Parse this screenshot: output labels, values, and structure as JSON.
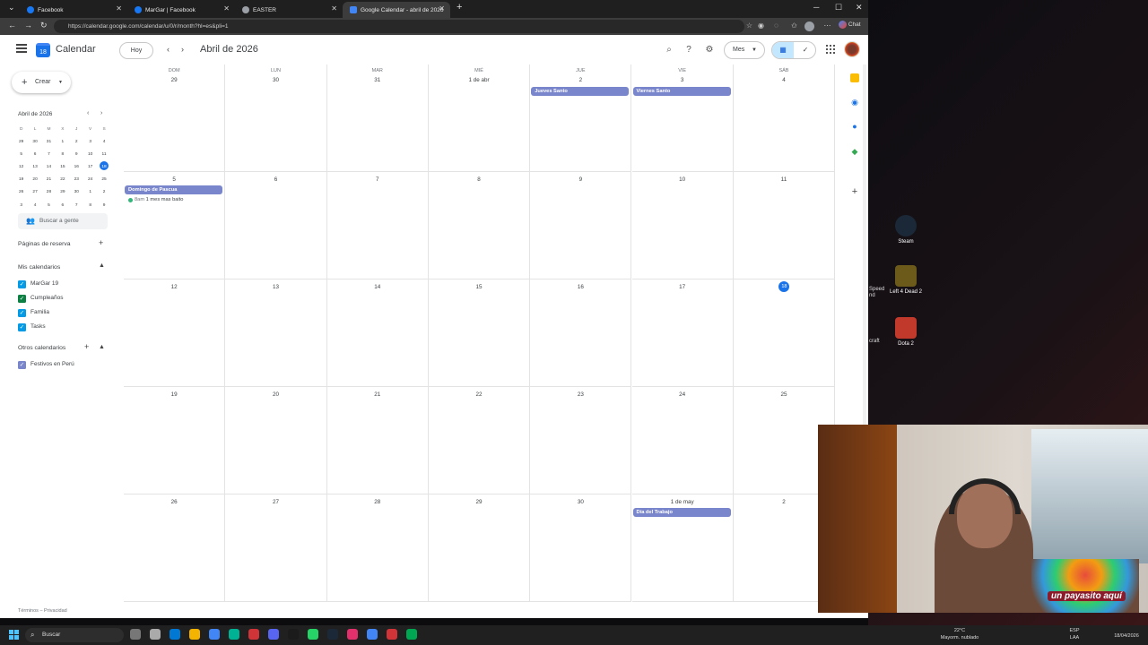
{
  "browser": {
    "tabs": [
      {
        "title": "Facebook",
        "favicon_color": "#1877f2"
      },
      {
        "title": "MarGar | Facebook",
        "favicon_color": "#1877f2"
      },
      {
        "title": "EASTER",
        "favicon_color": "#9aa0a6"
      },
      {
        "title": "Google Calendar - abril de 2026",
        "favicon_color": "#4285f4",
        "active": true
      }
    ],
    "url": "https://calendar.google.com/calendar/u/0/r/month?hl=es&pli=1",
    "chat_label": "Chat"
  },
  "header": {
    "app_name": "Calendar",
    "logo_text": "18",
    "today_label": "Hoy",
    "period_title": "Abril de 2026",
    "view_label": "Mes"
  },
  "sidebar": {
    "create_label": "Crear",
    "mini_calendar": {
      "title": "Abril de 2026",
      "weekdays": [
        "D",
        "L",
        "M",
        "X",
        "J",
        "V",
        "S"
      ],
      "weeks": [
        [
          "29",
          "30",
          "31",
          "1",
          "2",
          "3",
          "4"
        ],
        [
          "5",
          "6",
          "7",
          "8",
          "9",
          "10",
          "11"
        ],
        [
          "12",
          "13",
          "14",
          "15",
          "16",
          "17",
          "18"
        ],
        [
          "19",
          "20",
          "21",
          "22",
          "23",
          "24",
          "25"
        ],
        [
          "26",
          "27",
          "28",
          "29",
          "30",
          "1",
          "2"
        ],
        [
          "3",
          "4",
          "5",
          "6",
          "7",
          "8",
          "9"
        ]
      ],
      "today": "18"
    },
    "people_search_placeholder": "Buscar a gente",
    "booking_pages_label": "Páginas de reserva",
    "my_calendars_label": "Mis calendarios",
    "my_calendars": [
      {
        "name": "MarGar 19",
        "color": "#039be5"
      },
      {
        "name": "Cumpleaños",
        "color": "#0b8043"
      },
      {
        "name": "Familia",
        "color": "#039be5"
      },
      {
        "name": "Tasks",
        "color": "#039be5"
      }
    ],
    "other_calendars_label": "Otros calendarios",
    "other_calendars": [
      {
        "name": "Festivos en Perú",
        "color": "#7986cb"
      }
    ],
    "footer": "Términos – Privacidad"
  },
  "month": {
    "weekdays": [
      "DOM",
      "LUN",
      "MAR",
      "MIÉ",
      "JUE",
      "VIE",
      "SÁB"
    ],
    "weeks": [
      [
        "29",
        "30",
        "31",
        "1 de abr",
        "2",
        "3",
        "4"
      ],
      [
        "5",
        "6",
        "7",
        "8",
        "9",
        "10",
        "11"
      ],
      [
        "12",
        "13",
        "14",
        "15",
        "16",
        "17",
        "18"
      ],
      [
        "19",
        "20",
        "21",
        "22",
        "23",
        "24",
        "25"
      ],
      [
        "26",
        "27",
        "28",
        "29",
        "30",
        "1 de may",
        "2"
      ]
    ],
    "today": {
      "week": 2,
      "day": 6
    },
    "event_color": "#7986cb",
    "events": [
      {
        "week": 0,
        "day": 4,
        "title": "Jueves Santo"
      },
      {
        "week": 0,
        "day": 5,
        "title": "Viernes Santo"
      },
      {
        "week": 1,
        "day": 0,
        "title": "Domingo de Pascua"
      },
      {
        "week": 4,
        "day": 5,
        "title": "Día del Trabajo"
      }
    ],
    "timed_events": [
      {
        "week": 1,
        "day": 0,
        "time": "8am",
        "title": "1 mes mas baito"
      }
    ]
  },
  "desktop": {
    "icons": [
      {
        "label": "Steam",
        "color": "#1b2838"
      },
      {
        "label": "Left 4 Dead 2",
        "color": "#3a3a1a"
      },
      {
        "label": "Dota 2",
        "color": "#c0392b"
      }
    ],
    "partial_labels": [
      "Speed",
      "nd",
      "craft"
    ]
  },
  "webcam": {
    "caption": "un payasito aquí"
  },
  "taskbar": {
    "search_placeholder": "Buscar",
    "weather_temp": "22°C",
    "weather_desc": "Mayorm. nublado",
    "language": "ESP",
    "language_sub": "LAA",
    "date": "18/04/2026",
    "app_colors": [
      "#777",
      "#aaa",
      "#0078d4",
      "#f3b300",
      "#4285f4",
      "#00b294",
      "#d13438",
      "#5865f2",
      "#1b1b1b",
      "#25d366",
      "#1b2838",
      "#e1306c",
      "#4285f4",
      "#d13438",
      "#00a651"
    ]
  }
}
